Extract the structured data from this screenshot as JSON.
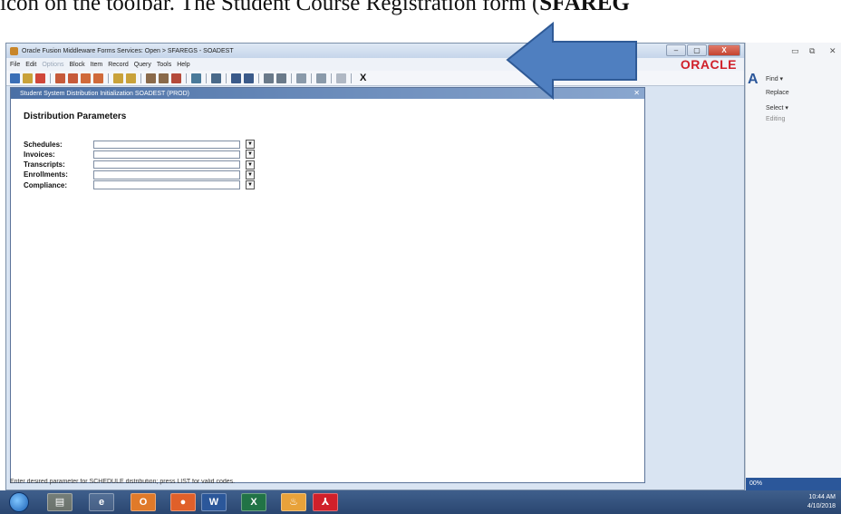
{
  "caption": {
    "text": "icon on the toolbar. The Student Course Registration form (",
    "bold": "SFAREG"
  },
  "window": {
    "title": "Oracle Fusion Middleware Forms Services:  Open > SFAREGS - SOADEST",
    "controls": [
      "–",
      "▢",
      "X"
    ]
  },
  "menu": {
    "items": [
      "File",
      "Edit",
      "Options",
      "Block",
      "Item",
      "Record",
      "Query",
      "Tools",
      "Help"
    ],
    "logo": "ORACLE"
  },
  "toolbar": {
    "close_label": "X"
  },
  "form": {
    "title": "Student System Distribution Initialization  SOADEST  (PROD)",
    "close": "✕",
    "section_title": "Distribution Parameters",
    "fields": [
      {
        "label": "Schedules:",
        "value": ""
      },
      {
        "label": "Invoices:",
        "value": ""
      },
      {
        "label": "Transcripts:",
        "value": ""
      },
      {
        "label": "Enrollments:",
        "value": ""
      },
      {
        "label": "Compliance:",
        "value": ""
      }
    ]
  },
  "status": {
    "text": "Enter desired parameter for SCHEDULE distribution; press LIST for valid codes."
  },
  "ribbon": {
    "find": "Find ▾",
    "replace": "Replace",
    "select": "Select ▾",
    "group": "Editing",
    "zoom": "00%"
  },
  "taskbar": {
    "time": "10:44 AM",
    "date": "4/10/2018"
  }
}
